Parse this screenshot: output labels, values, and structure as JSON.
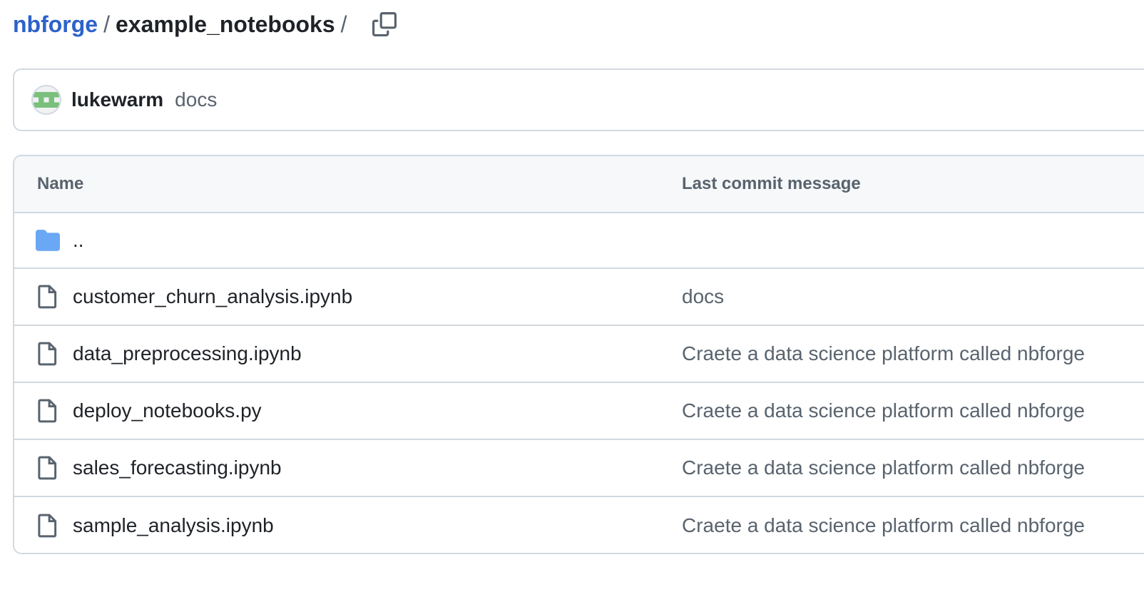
{
  "breadcrumb": {
    "repo": "nbforge",
    "separator": "/",
    "folder": "example_notebooks",
    "trailing_separator": "/"
  },
  "latest_commit": {
    "author": "lukewarm",
    "message": "docs"
  },
  "table": {
    "headers": {
      "name": "Name",
      "last_commit_message": "Last commit message"
    },
    "parent_row": {
      "name": "..",
      "icon": "folder-icon"
    },
    "rows": [
      {
        "name": "customer_churn_analysis.ipynb",
        "message": "docs",
        "icon": "file-icon"
      },
      {
        "name": "data_preprocessing.ipynb",
        "message": "Craete a data science platform called nbforge",
        "icon": "file-icon"
      },
      {
        "name": "deploy_notebooks.py",
        "message": "Craete a data science platform called nbforge",
        "icon": "file-icon"
      },
      {
        "name": "sales_forecasting.ipynb",
        "message": "Craete a data science platform called nbforge",
        "icon": "file-icon"
      },
      {
        "name": "sample_analysis.ipynb",
        "message": "Craete a data science platform called nbforge",
        "icon": "file-icon"
      }
    ]
  },
  "colors": {
    "link": "#2c62c9",
    "folder": "#6aa7f5",
    "muted": "#59636e",
    "border": "#d1d9e0",
    "header_bg": "#f6f8fa"
  }
}
